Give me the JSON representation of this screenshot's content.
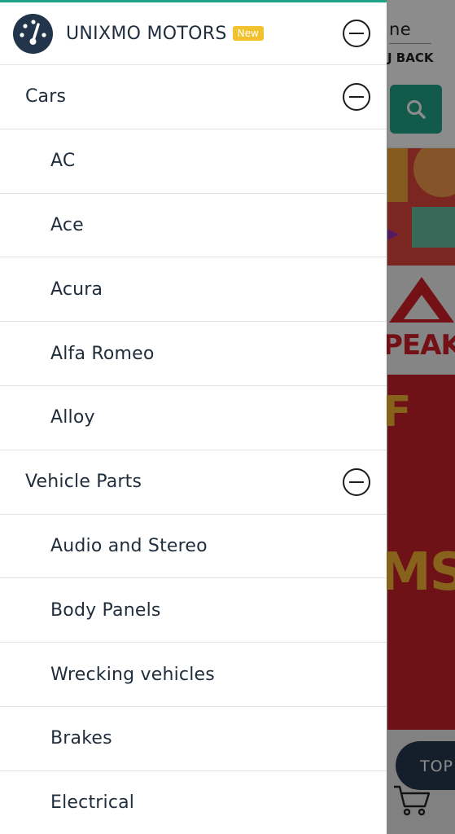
{
  "background_page": {
    "partial_title": "ne",
    "partial_back_text": "J BACK",
    "partial_promo_letter": "F",
    "partial_promo_text": "MS",
    "partial_brand_text": "PEAK",
    "partial_top_button": "TOP",
    "search_icon": "search-icon",
    "cart_icon": "shopping-cart-icon",
    "colors": {
      "accent": "#1fa48a",
      "promo_red": "#c9212a",
      "promo_yellow": "#f5b335",
      "dark_navy": "#263a4f"
    }
  },
  "drawer": {
    "brand": {
      "logo_icon": "speedometer-icon",
      "title": "UNIXMO MOTORS",
      "badge": "New",
      "collapse_icon": "minus-circle-icon"
    },
    "categories": [
      {
        "label": "Cars",
        "expanded": true,
        "collapse_icon": "minus-circle-icon",
        "items": [
          "AC",
          "Ace",
          "Acura",
          "Alfa Romeo",
          "Alloy"
        ]
      },
      {
        "label": "Vehicle Parts",
        "expanded": true,
        "collapse_icon": "minus-circle-icon",
        "items": [
          "Audio and Stereo",
          "Body Panels",
          "Wrecking vehicles",
          "Brakes",
          "Electrical"
        ]
      }
    ],
    "colors": {
      "top_border": "#1fa48a",
      "badge": "#f2c12e",
      "text": "#1f2d3d",
      "logo_bg": "#22354a"
    }
  }
}
